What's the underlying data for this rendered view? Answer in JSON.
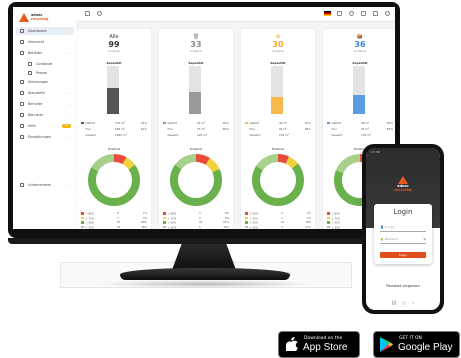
{
  "sidebar": {
    "brand": [
      "adnac",
      "recycling"
    ],
    "items": [
      {
        "label": "Dashboard",
        "active": true,
        "icon": "dashboard-icon"
      },
      {
        "label": "Übersicht",
        "icon": "globe-icon"
      },
      {
        "label": "Behälter",
        "chev": "⌄",
        "icon": "bin-icon"
      },
      {
        "label": "Container",
        "sub": true,
        "icon": "container-icon"
      },
      {
        "label": "Presse",
        "sub": true,
        "icon": "press-icon"
      },
      {
        "label": "Abholungen",
        "icon": "truck-icon"
      },
      {
        "label": "Standorte",
        "chev": "⌄",
        "icon": "location-icon"
      },
      {
        "label": "Berichte",
        "chev": "⌄",
        "icon": "report-icon"
      },
      {
        "label": "Benutzer",
        "chev": "⌄",
        "icon": "user-icon"
      },
      {
        "label": "Hilfe",
        "badge": "neu",
        "icon": "help-icon"
      },
      {
        "label": "Einstellungen",
        "chev": "⌄",
        "icon": "gear-icon"
      },
      {
        "label": "Unternehmen",
        "chev": "⌄",
        "icon": "company-icon",
        "bottom": true
      }
    ]
  },
  "cards": [
    {
      "title": "Alle",
      "icon": "",
      "count": "99",
      "sub": "Container",
      "color": "#333333",
      "fill": 0.55,
      "fillColor": "#555555",
      "rows": [
        [
          "Gefüllt",
          "375 m³",
          "32%"
        ],
        [
          "Frei",
          "684 m³",
          "61%"
        ],
        [
          "Gesamt",
          "1060 m³",
          ""
        ]
      ],
      "legend": [
        [
          "> 85%",
          "9",
          "7%"
        ],
        [
          "> 75%",
          "7",
          "7%"
        ],
        [
          "> 50%",
          "67",
          "68%"
        ],
        [
          "< 25%",
          "16",
          "16%"
        ]
      ],
      "donut": [
        0.08,
        0.07,
        0.68,
        0.17
      ]
    },
    {
      "title": "",
      "icon": "trash-icon",
      "count": "33",
      "sub": "Container",
      "color": "#888888",
      "fill": 0.45,
      "fillColor": "#999999",
      "rows": [
        [
          "Gefüllt",
          "61 m³",
          "40%"
        ],
        [
          "Frei",
          "75 m³",
          "60%"
        ],
        [
          "Gesamt",
          "126 m³",
          ""
        ]
      ],
      "legend": [
        [
          "> 85%",
          "3",
          "9%"
        ],
        [
          "> 75%",
          "3",
          "9%"
        ],
        [
          "> 50%",
          "22",
          "67%"
        ],
        [
          "< 25%",
          "5",
          "15%"
        ]
      ],
      "donut": [
        0.09,
        0.09,
        0.67,
        0.15
      ]
    },
    {
      "title": "",
      "icon": "recycle-icon",
      "count": "30",
      "sub": "Container",
      "color": "#f5a623",
      "fill": 0.35,
      "fillColor": "#f7b94e",
      "rows": [
        [
          "Gefüllt",
          "44 m³",
          "32%"
        ],
        [
          "Frei",
          "94 m³",
          "68%"
        ],
        [
          "Gesamt",
          "135 m³",
          ""
        ]
      ],
      "legend": [
        [
          "> 85%",
          "2",
          "7%"
        ],
        [
          "> 75%",
          "2",
          "7%"
        ],
        [
          "> 50%",
          "21",
          "70%"
        ],
        [
          "< 25%",
          "5",
          "17%"
        ]
      ],
      "donut": [
        0.07,
        0.07,
        0.7,
        0.16
      ]
    },
    {
      "title": "",
      "icon": "box-icon",
      "count": "36",
      "sub": "Container",
      "color": "#3a86d8",
      "fill": 0.4,
      "fillColor": "#5b9de0",
      "rows": [
        [
          "Gefüllt",
          "48 m³",
          "35%"
        ],
        [
          "Frei",
          "91 m³",
          "65%"
        ],
        [
          "Gesamt",
          "139 m³",
          ""
        ]
      ],
      "legend": [
        [
          "> 85%",
          "2",
          "6%"
        ],
        [
          "> 75%",
          "2",
          "6%"
        ],
        [
          "> 50%",
          "25",
          "69%"
        ],
        [
          "< 25%",
          "7",
          "19%"
        ]
      ],
      "donut": [
        0.06,
        0.06,
        0.69,
        0.19
      ]
    }
  ],
  "labels": {
    "capacity": "Kapazität",
    "fill": "Füllstand"
  },
  "colors": {
    "red": "#e84c3d",
    "yellow": "#f4d03f",
    "green": "#6ab04c",
    "lightgreen": "#a8d08d"
  },
  "phone": {
    "time": "17:30",
    "brand": [
      "adnac",
      "recycling"
    ],
    "login": "Login",
    "email_placeholder": "E-mail",
    "password_placeholder": "Passwort",
    "button": "Login",
    "forgot": "Passwort vergessen"
  },
  "appstore": {
    "small": "Download on the",
    "big": "App Store"
  },
  "googleplay": {
    "small": "GET IT ON",
    "big": "Google Play"
  }
}
